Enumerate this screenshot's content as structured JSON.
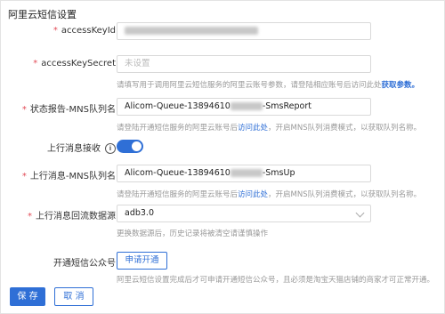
{
  "title": "阿里云短信设置",
  "fields": {
    "access_key_id": {
      "label": "accessKeyId",
      "required_mark": "*"
    },
    "access_key_secret": {
      "label": "accessKeySecret",
      "required_mark": "*",
      "placeholder": "未设置",
      "hint": "请填写用于调用阿里云短信服务的阿里云账号参数，请登陆相应账号后访问此处",
      "hint_link": "获取参数。"
    },
    "status_report_queue": {
      "label": "状态报告-MNS队列名",
      "required_mark": "*",
      "value_prefix": "Alicom-Queue-13894610",
      "value_suffix": "-SmsReport",
      "hint_prefix": "请登陆开通短信服务的阿里云账号后",
      "hint_link": "访问此处",
      "hint_suffix": "，开启MNS队列消费模式，以获取队列名称。"
    },
    "upstream_receive": {
      "label": "上行消息接收",
      "info_icon": "i",
      "enabled": true
    },
    "upstream_queue": {
      "label": "上行消息-MNS队列名",
      "required_mark": "*",
      "value_prefix": "Alicom-Queue-13894610",
      "value_suffix": "-SmsUp",
      "hint_prefix": "请登陆开通短信服务的阿里云账号后",
      "hint_link": "访问此处",
      "hint_suffix": "，开启MNS队列消费模式，以获取队列名称。"
    },
    "upstream_datasource": {
      "label": "上行消息回流数据源",
      "required_mark": "*",
      "value": "adb3.0",
      "hint": "更换数据源后，历史记录将被清空请谨慎操作"
    },
    "official_account": {
      "label": "开通短信公众号",
      "button": "申请开通",
      "hint": "阿里云短信设置完成后才可申请开通短信公众号，且必须是淘宝天猫店铺的商家才可正常开通。"
    }
  },
  "actions": {
    "save": "保 存",
    "cancel": "取 消"
  },
  "colors": {
    "accent": "#2f6fd6",
    "required": "#e34d59",
    "hint": "#999999"
  }
}
